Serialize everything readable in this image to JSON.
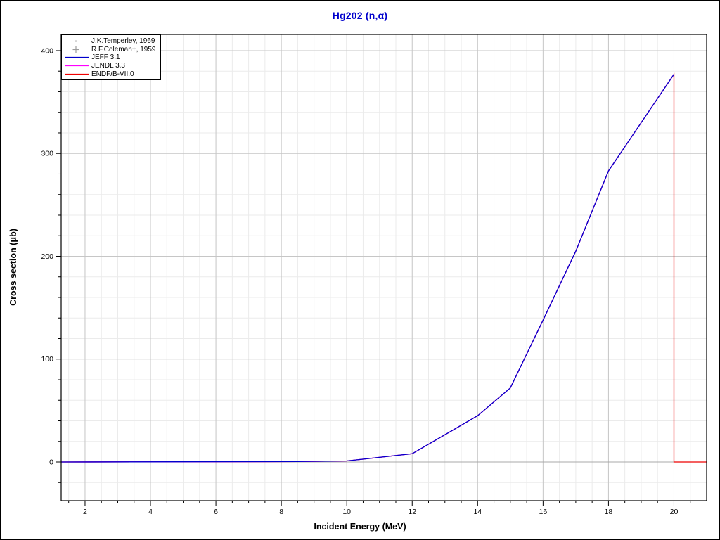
{
  "title": {
    "text": "Hg202 (n,α)",
    "color": "#0000CC"
  },
  "axes": {
    "x": {
      "label": "Incident Energy (MeV)",
      "min": 1.27,
      "max": 21,
      "major_ticks": [
        2,
        4,
        6,
        8,
        10,
        12,
        14,
        16,
        18,
        20
      ],
      "minor_step": 0.5
    },
    "y": {
      "label": "Cross section (μb)",
      "min": -37.6,
      "max": 415.7,
      "major_ticks": [
        0,
        100,
        200,
        300,
        400
      ],
      "minor_step": 20
    }
  },
  "legend": {
    "entries": [
      {
        "label": "J.K.Temperley, 1969",
        "marker": "dot",
        "color": "#C4C4C4"
      },
      {
        "label": "R.F.Coleman+, 1959",
        "marker": "plus",
        "color": "#9C9C9C"
      },
      {
        "label": "JEFF 3.1",
        "marker": "line",
        "color": "#0000CC"
      },
      {
        "label": "JENDL 3.3",
        "marker": "line",
        "color": "#FF00FF"
      },
      {
        "label": "ENDF/B-VII.0",
        "marker": "line",
        "color": "#EE0000"
      }
    ]
  },
  "colors": {
    "grid_major": "#C6C6C6",
    "grid_minor": "#EBEBEB",
    "zero_line": "#A8A8A8",
    "frame": "#000000",
    "tick": "#000000",
    "tick_label": "#000000"
  },
  "chart_data": {
    "type": "line",
    "title": "Hg202 (n,α)",
    "xlabel": "Incident Energy (MeV)",
    "ylabel": "Cross section (μb)",
    "xlim": [
      1.27,
      21
    ],
    "ylim": [
      -37.6,
      415.7
    ],
    "x_major_tick_interval": 2,
    "x_minor_tick_interval": 0.5,
    "y_major_tick_interval": 100,
    "y_minor_tick_interval": 20,
    "grid": true,
    "legend_position": "top-left",
    "series": [
      {
        "name": "J.K.Temperley, 1969",
        "type": "scatter",
        "marker": "dot",
        "color": "#C4C4C4",
        "points": [],
        "note": "legend entry only; no markers discernible in plot area (values near 0, hidden under curves)"
      },
      {
        "name": "R.F.Coleman+, 1959",
        "type": "scatter",
        "marker": "plus",
        "color": "#9C9C9C",
        "points": [],
        "note": "legend entry only; no markers discernible in plot area (values near 0, hidden under curves)"
      },
      {
        "name": "JEFF 3.1",
        "type": "line",
        "color": "#0000CC",
        "points": [
          [
            1.27,
            0
          ],
          [
            8.5,
            0.4
          ],
          [
            10,
            1
          ],
          [
            12,
            8
          ],
          [
            14,
            45
          ],
          [
            15,
            72
          ],
          [
            16,
            138
          ],
          [
            17,
            205
          ],
          [
            18,
            283
          ],
          [
            20,
            377
          ]
        ]
      },
      {
        "name": "JENDL 3.3",
        "type": "line",
        "color": "#FF00FF",
        "points": [
          [
            1.27,
            0
          ],
          [
            8.5,
            0.4
          ],
          [
            10,
            1
          ],
          [
            12,
            8
          ],
          [
            14,
            45
          ],
          [
            15,
            72
          ],
          [
            16,
            138
          ],
          [
            17,
            205
          ],
          [
            18,
            283
          ],
          [
            20,
            377
          ]
        ],
        "note": "coincides with JEFF 3.1, hidden beneath blue curve"
      },
      {
        "name": "ENDF/B-VII.0",
        "type": "line",
        "color": "#EE0000",
        "points": [
          [
            1.27,
            0
          ],
          [
            8.5,
            0.4
          ],
          [
            10,
            1
          ],
          [
            12,
            8
          ],
          [
            14,
            45
          ],
          [
            15,
            72
          ],
          [
            16,
            138
          ],
          [
            17,
            205
          ],
          [
            18,
            283
          ],
          [
            20,
            377
          ],
          [
            20,
            0
          ],
          [
            20.99,
            0
          ]
        ],
        "note": "tracks JEFF curve then drops to 0 at 20 MeV and stays 0 to 21 MeV"
      }
    ]
  }
}
